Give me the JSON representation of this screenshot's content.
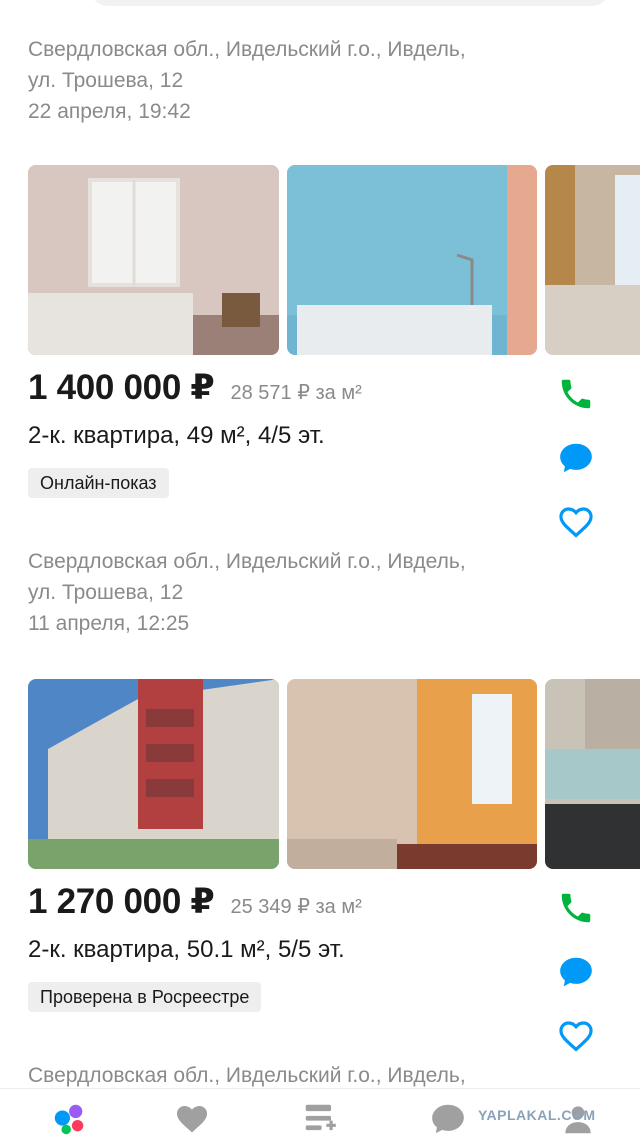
{
  "listings": [
    {
      "address_line1": "Свердловская обл., Ивдельский г.о., Ивдель,",
      "address_line2": "ул. Трошева, 12",
      "date": "22 апреля, 19:42"
    },
    {
      "price": "1 400 000 ₽",
      "price_per_m2": "28 571 ₽ за м²",
      "title": "2-к. квартира, 49 м², 4/5 эт.",
      "badge": "Онлайн-показ",
      "address_line1": "Свердловская обл., Ивдельский г.о., Ивдель,",
      "address_line2": "ул. Трошева, 12",
      "date": "11 апреля, 12:25",
      "photos": [
        "bedroom-photo",
        "bathroom-photo",
        "room-bed-photo"
      ]
    },
    {
      "price": "1 270 000 ₽",
      "price_per_m2": "25 349 ₽ за м²",
      "title": "2-к. квартира, 50.1 м², 5/5 эт.",
      "badge": "Проверена в Росреестре",
      "address_line1": "Свердловская обл., Ивдельский г.о., Ивдель,",
      "photos": [
        "building-exterior-photo",
        "room-window-photo",
        "kitchen-photo"
      ]
    }
  ],
  "actions": {
    "call_icon": "phone-icon",
    "message_icon": "chat-icon",
    "favorite_icon": "heart-icon"
  },
  "bottom_nav": {
    "items": [
      "home-icon",
      "favorites-icon",
      "add-listing-icon",
      "messages-icon",
      "profile-icon"
    ]
  },
  "watermark": "YAPLAKAL.COM",
  "colors": {
    "accent_green": "#00b33c",
    "accent_blue": "#0099f7",
    "text_primary": "#1a1a1a",
    "text_secondary": "#8a8a8a",
    "badge_bg": "#eeeeee"
  }
}
